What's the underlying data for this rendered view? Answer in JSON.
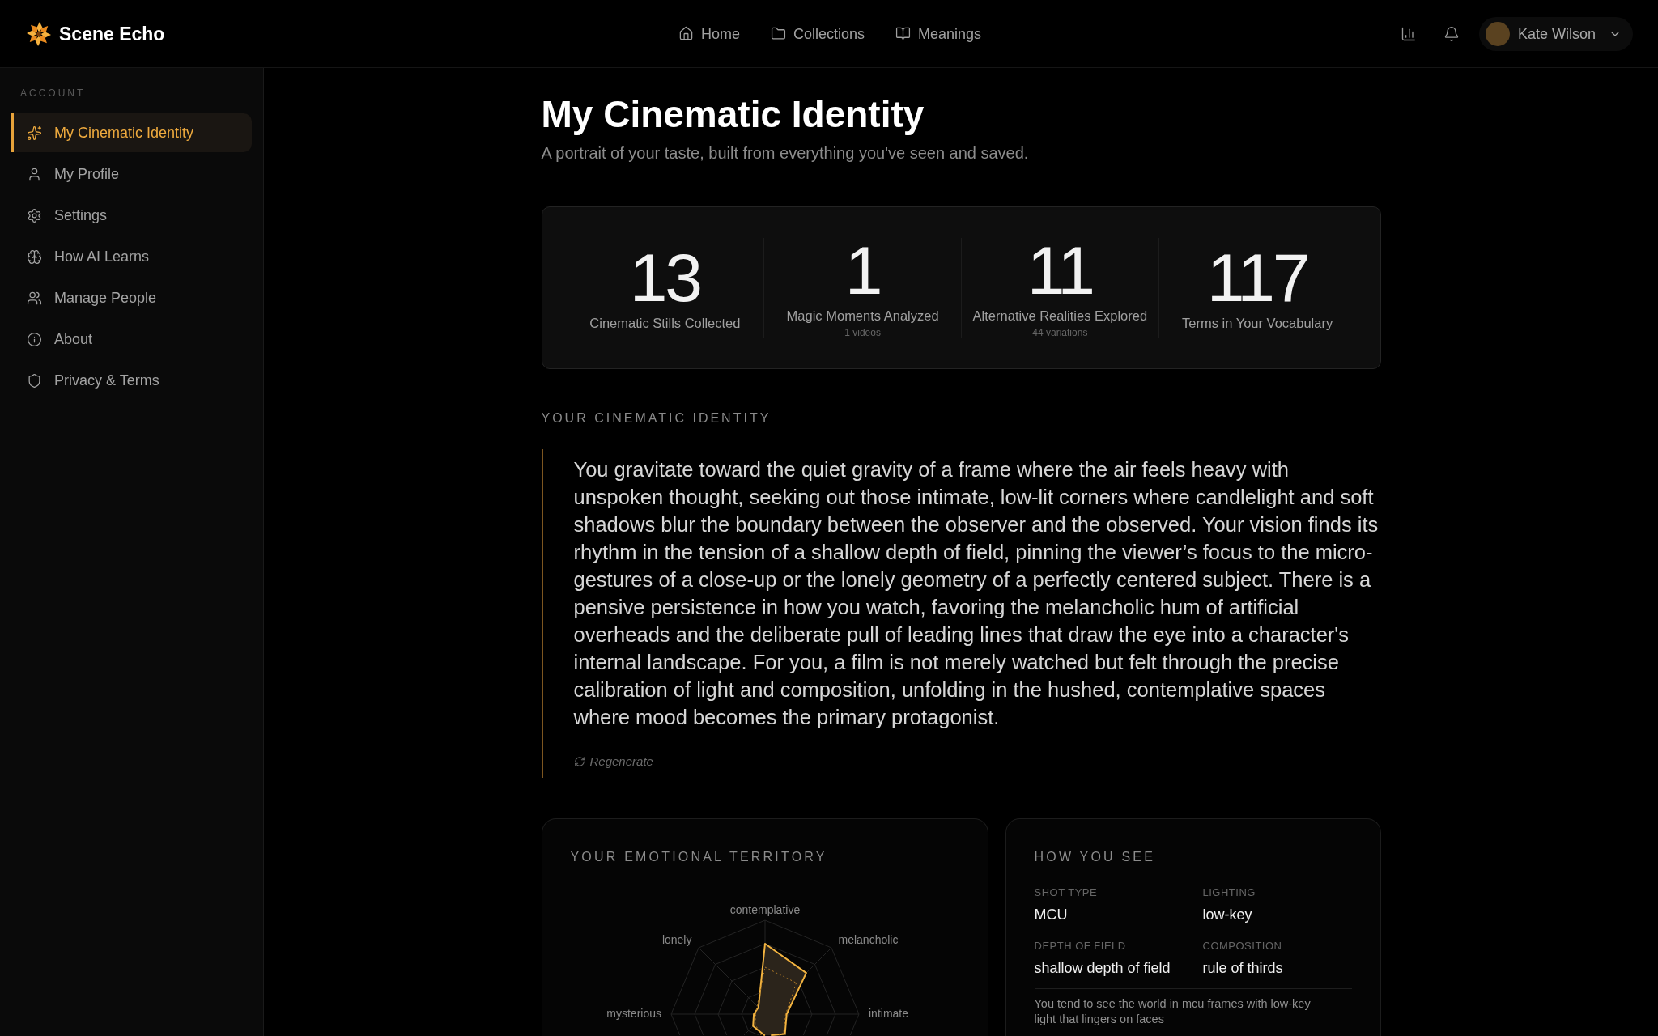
{
  "app": {
    "name": "Scene Echo"
  },
  "nav": [
    {
      "label": "Home"
    },
    {
      "label": "Collections"
    },
    {
      "label": "Meanings"
    }
  ],
  "user": {
    "name": "Kate Wilson"
  },
  "sidebar": {
    "section": "ACCOUNT",
    "items": [
      {
        "label": "My Cinematic Identity",
        "selected": true
      },
      {
        "label": "My Profile",
        "selected": false
      },
      {
        "label": "Settings",
        "selected": false
      },
      {
        "label": "How AI Learns",
        "selected": false
      },
      {
        "label": "Manage People",
        "selected": false
      },
      {
        "label": "About",
        "selected": false
      },
      {
        "label": "Privacy & Terms",
        "selected": false
      }
    ]
  },
  "page": {
    "title": "My Cinematic Identity",
    "subtitle": "A portrait of your taste, built from everything you've seen and saved."
  },
  "stats": [
    {
      "value": "13",
      "label": "Cinematic Stills Collected"
    },
    {
      "value": "1",
      "label": "Magic Moments Analyzed",
      "detail": "1 videos"
    },
    {
      "value": "11",
      "label": "Alternative Realities Explored",
      "detail": "44 variations"
    },
    {
      "value": "117",
      "label": "Terms in Your Vocabulary"
    }
  ],
  "identity": {
    "heading": "YOUR CINEMATIC IDENTITY",
    "text": "You gravitate toward the quiet gravity of a frame where the air feels heavy with unspoken thought, seeking out those intimate, low-lit corners where candlelight and soft shadows blur the boundary between the observer and the observed. Your vision finds its rhythm in the tension of a shallow depth of field, pinning the viewer’s focus to the micro-gestures of a close-up or the lonely geometry of a perfectly centered subject. There is a pensive persistence in how you watch, favoring the melancholic hum of artificial overheads and the deliberate pull of leading lines that draw the eye into a character's internal landscape. For you, a film is not merely watched but felt through the precise calibration of light and composition, unfolding in the hushed, contemplative spaces where mood becomes the primary protagonist.",
    "action": "Regenerate"
  },
  "emotional_territory": {
    "title": "YOUR EMOTIONAL TERRITORY",
    "axes": [
      "contemplative",
      "melancholic",
      "intimate",
      "mysterious",
      "lonely"
    ]
  },
  "how_you_see": {
    "title": "HOW YOU SEE",
    "attributes": [
      {
        "label": "SHOT TYPE",
        "value": "MCU"
      },
      {
        "label": "LIGHTING",
        "value": "low-key"
      },
      {
        "label": "DEPTH OF FIELD",
        "value": "shallow depth of field"
      },
      {
        "label": "COMPOSITION",
        "value": "rule of thirds"
      }
    ],
    "summary": "You tend to see the world in mcu frames with low-key light that lingers on faces"
  }
}
